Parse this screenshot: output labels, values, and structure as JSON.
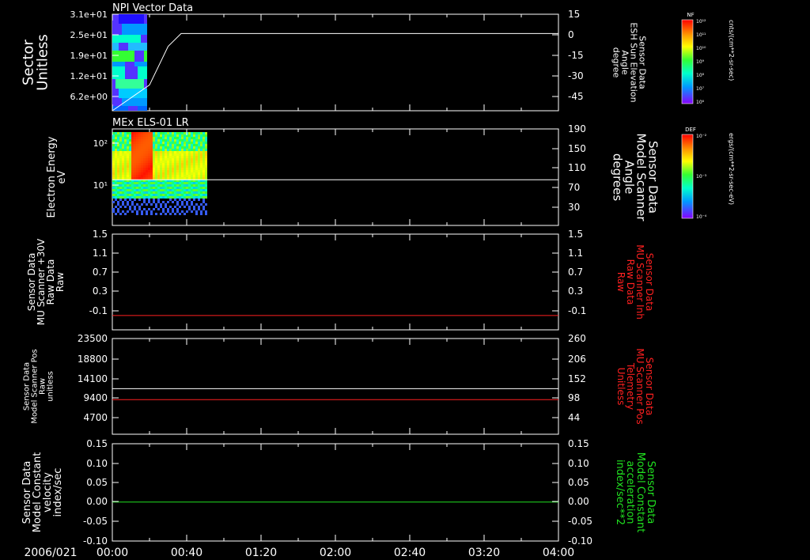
{
  "date_label": "2006/021",
  "time_ticks": [
    "00:00",
    "00:40",
    "01:20",
    "02:00",
    "02:40",
    "03:20",
    "04:00"
  ],
  "colors": {
    "white": "#ffffff",
    "red": "#ff2020",
    "green": "#20e020"
  },
  "chart_data": [
    {
      "type": "heatmap",
      "title": "NPI Vector Data",
      "left_axis": {
        "label": [
          "Sector",
          "Unitless"
        ],
        "ticks": [
          "3.1e+01",
          "2.5e+01",
          "1.9e+01",
          "1.2e+01",
          "6.2e+00"
        ]
      },
      "right_axis": {
        "label": [
          "Sensor Data",
          "ESH Sun Elevation",
          "Angle",
          "degree"
        ],
        "ticks": [
          "15",
          "0",
          "-15",
          "-30",
          "-45"
        ],
        "ylim": [
          -60,
          15
        ]
      },
      "line": {
        "name": "Sun Elevation Angle",
        "x_minutes": [
          0,
          20,
          30,
          37,
          240
        ],
        "y": [
          -60,
          -40,
          -10,
          0,
          0
        ]
      },
      "data_extent_minutes": [
        0,
        18
      ],
      "colorbar": {
        "label": "NF",
        "unit": "cnts/(cm**2-sr-sec)",
        "ticks": [
          "10¹²",
          "10¹¹",
          "10¹⁰",
          "10⁹",
          "10⁸",
          "10⁷",
          "10⁶"
        ]
      }
    },
    {
      "type": "heatmap",
      "title": "MEx ELS-01 LR",
      "left_axis": {
        "label": [
          "Electron Energy",
          "eV"
        ],
        "ticks": [
          "10²",
          "10¹"
        ],
        "scale": "log"
      },
      "right_axis": {
        "label": [
          "Sensor Data",
          "Model Scanner",
          "Angle",
          "degrees"
        ],
        "ticks": [
          "190",
          "150",
          "110",
          "70",
          "30"
        ],
        "ylim": [
          0,
          190
        ]
      },
      "line": {
        "name": "Model Scanner Angle",
        "x_minutes": [
          0,
          240
        ],
        "y": [
          90,
          90
        ]
      },
      "data_extent_minutes": [
        0,
        51
      ],
      "colorbar": {
        "label": "DEF",
        "unit": "ergs/(cm**2-sr-sec-eV)",
        "ticks": [
          "10⁻²",
          "10⁻³",
          "10⁻⁴"
        ]
      }
    },
    {
      "type": "line",
      "left_axis": {
        "label": [
          "Sensor Data",
          "MU Scanner +30V",
          "Raw Data",
          "Raw"
        ],
        "ticks": [
          "1.5",
          "1.1",
          "0.7",
          "0.3",
          "-0.1"
        ],
        "ylim": [
          -0.3,
          1.5
        ]
      },
      "right_axis": {
        "label": [
          "Sensor Data",
          "MU Scanner Inh",
          "Raw Data",
          "Raw"
        ],
        "ticks": [
          "1.5",
          "1.1",
          "0.7",
          "0.3",
          "-0.1"
        ],
        "ylim": [
          -0.3,
          1.5
        ]
      },
      "series": [
        {
          "color": "red",
          "x_minutes": [
            0,
            240
          ],
          "y": [
            -0.03,
            -0.03
          ]
        }
      ]
    },
    {
      "type": "line",
      "left_axis": {
        "label": [
          "Sensor Data",
          "Model Scanner Pos",
          "Raw",
          "unitless"
        ],
        "ticks": [
          "23500",
          "18800",
          "14100",
          "9400",
          "4700"
        ],
        "ylim": [
          0,
          23500
        ]
      },
      "right_axis": {
        "label": [
          "Sensor Data",
          "MU Scanner Pos",
          "Telemetry",
          "Unitless"
        ],
        "ticks": [
          "260",
          "206",
          "152",
          "98",
          "44"
        ],
        "ylim": [
          0,
          260
        ]
      },
      "series": [
        {
          "color": "white",
          "axis": "left",
          "x_minutes": [
            0,
            240
          ],
          "y": [
            11200,
            11200
          ]
        },
        {
          "color": "red",
          "axis": "left",
          "x_minutes": [
            0,
            240
          ],
          "y": [
            8500,
            8500
          ]
        }
      ]
    },
    {
      "type": "line",
      "left_axis": {
        "label": [
          "Sensor Data",
          "Model Constant",
          "velocity",
          "index/sec"
        ],
        "ticks": [
          "0.15",
          "0.10",
          "0.05",
          "0.00",
          "-0.05",
          "-0.10"
        ],
        "ylim": [
          -0.1,
          0.15
        ]
      },
      "right_axis": {
        "label": [
          "Sensor Data",
          "Model Constant",
          "acceleration",
          "index/sec**2"
        ],
        "ticks": [
          "0.15",
          "0.10",
          "0.05",
          "0.00",
          "-0.05",
          "-0.10"
        ],
        "ylim": [
          -0.1,
          0.15
        ]
      },
      "series": [
        {
          "color": "green",
          "x_minutes": [
            0,
            240
          ],
          "y": [
            0,
            0
          ]
        }
      ]
    }
  ]
}
